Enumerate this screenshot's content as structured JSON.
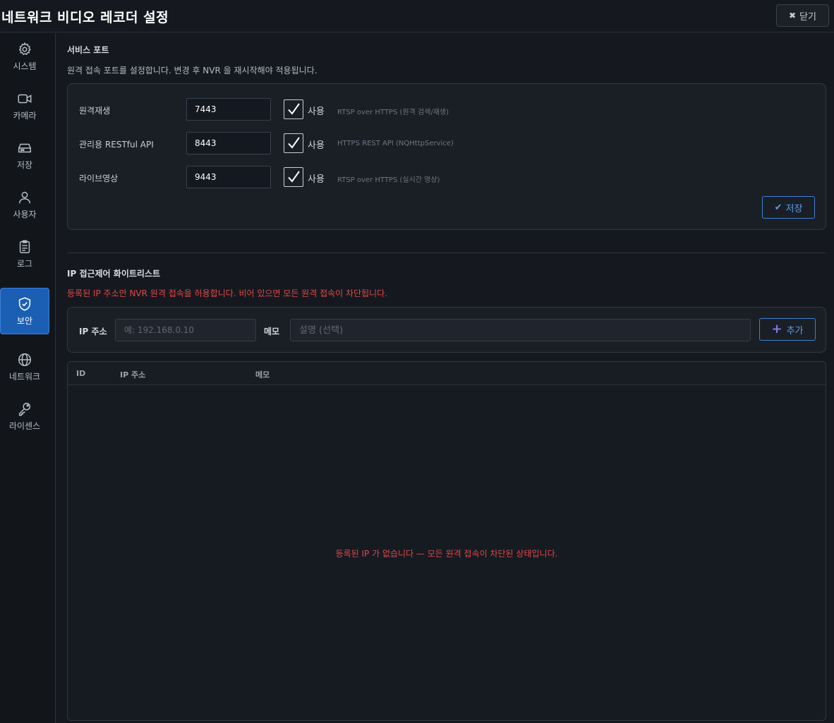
{
  "window": {
    "title": "네트워크 비디오 레코더 설정",
    "close_label": "닫기"
  },
  "sidebar": {
    "items": [
      {
        "label": "시스템",
        "icon": "gear-icon"
      },
      {
        "label": "카메라",
        "icon": "camera-icon"
      },
      {
        "label": "저장",
        "icon": "storage-icon"
      },
      {
        "label": "사용자",
        "icon": "user-icon"
      },
      {
        "label": "로그",
        "icon": "clipboard-icon"
      },
      {
        "label": "보안",
        "icon": "shield-icon",
        "active": true
      },
      {
        "label": "네트워크",
        "icon": "globe-icon"
      },
      {
        "label": "라이센스",
        "icon": "key-icon"
      }
    ]
  },
  "service_ports": {
    "title": "서비스 포트",
    "description": "원격 접속 포트를 설정합니다. 변경 후 NVR 을 재시작해야 적용됩니다.",
    "rows": [
      {
        "label": "원격재생",
        "port": "7443",
        "use_label": "사용",
        "enabled": true,
        "hint": "RTSP over HTTPS (원격 검색/재생)"
      },
      {
        "label": "관리용 RESTful API",
        "port": "8443",
        "use_label": "사용",
        "enabled": true,
        "hint": "HTTPS REST API (NQHttpService)"
      },
      {
        "label": "라이브영상",
        "port": "9443",
        "use_label": "사용",
        "enabled": true,
        "hint": "RTSP over HTTPS (실시간 영상)"
      }
    ],
    "save_label": "저장"
  },
  "ip_whitelist": {
    "title": "IP 접근제어 화이트리스트",
    "description": "등록된 IP 주소만 NVR 원격 접속을 허용합니다. 비어 있으면 모든 원격 접속이 차단됩니다.",
    "ip_label": "IP 주소",
    "ip_placeholder": "예: 192.168.0.10",
    "memo_label": "메모",
    "memo_placeholder": "설명 (선택)",
    "add_label": "추가",
    "columns": [
      "ID",
      "IP 주소",
      "메모"
    ],
    "rows": [],
    "empty_message": "등록된 IP 가 없습니다 — 모든 원격 접속이 차단된 상태입니다."
  },
  "colors": {
    "accent": "#1b5fb5",
    "warning": "#e0474a",
    "background": "#15191f"
  }
}
